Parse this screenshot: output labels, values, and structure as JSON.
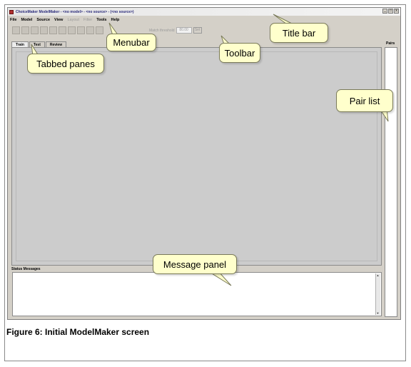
{
  "window": {
    "title": "ChoiceMaker ModelMaker - <no model> - <no source> - (<no source>)",
    "controls": [
      "_",
      "□",
      "x"
    ]
  },
  "menubar": {
    "items": [
      {
        "label": "File",
        "enabled": true
      },
      {
        "label": "Model",
        "enabled": true
      },
      {
        "label": "Source",
        "enabled": true
      },
      {
        "label": "View",
        "enabled": true
      },
      {
        "label": "Layout",
        "enabled": false
      },
      {
        "label": "Filter",
        "enabled": false
      },
      {
        "label": "Tools",
        "enabled": true
      },
      {
        "label": "Help",
        "enabled": true
      }
    ]
  },
  "toolbar": {
    "threshold_label": "Match threshold",
    "threshold_value": "80.00",
    "set_label": "Set"
  },
  "tabs": [
    {
      "label": "Train",
      "active": true
    },
    {
      "label": "Test",
      "active": false
    },
    {
      "label": "Review",
      "active": false
    }
  ],
  "pairs": {
    "header": "Pairs"
  },
  "status": {
    "label": "Status Messages",
    "scroll_up": "▲",
    "scroll_down": "▼"
  },
  "callouts": {
    "title_bar": "Title bar",
    "menubar": "Menubar",
    "toolbar": "Toolbar",
    "tabbed_panes": "Tabbed panes",
    "pair_list": "Pair list",
    "message_panel": "Message panel"
  },
  "caption": "Figure 6: Initial ModelMaker screen",
  "colors": {
    "window_bg": "#d4d0c8",
    "callout_bg": "#ffffcc",
    "pane_bg": "#cccccc"
  }
}
